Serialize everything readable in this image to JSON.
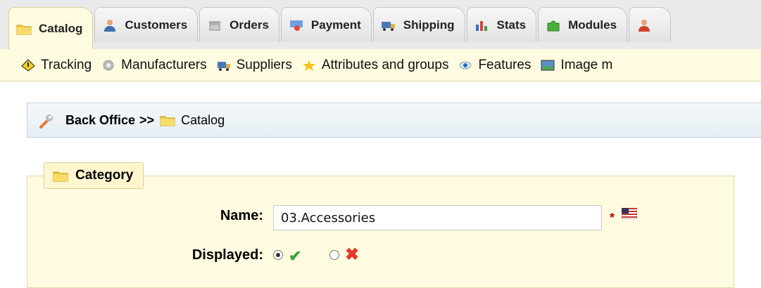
{
  "tabs": [
    {
      "label": "Catalog",
      "icon": "folder-icon",
      "active": true
    },
    {
      "label": "Customers",
      "icon": "customer-icon",
      "active": false
    },
    {
      "label": "Orders",
      "icon": "orders-icon",
      "active": false
    },
    {
      "label": "Payment",
      "icon": "payment-icon",
      "active": false
    },
    {
      "label": "Shipping",
      "icon": "truck-icon",
      "active": false
    },
    {
      "label": "Stats",
      "icon": "bar-chart-icon",
      "active": false
    },
    {
      "label": "Modules",
      "icon": "puzzle-icon",
      "active": false
    }
  ],
  "subnav": [
    {
      "label": "Tracking",
      "icon": "warning-icon"
    },
    {
      "label": "Manufacturers",
      "icon": "gear-icon"
    },
    {
      "label": "Suppliers",
      "icon": "truck-icon"
    },
    {
      "label": "Attributes and groups",
      "icon": "star-icon"
    },
    {
      "label": "Features",
      "icon": "eye-icon"
    },
    {
      "label": "Image m",
      "icon": "image-icon"
    }
  ],
  "breadcrumb": {
    "root": "Back Office",
    "separator": ">>",
    "current": "Catalog"
  },
  "form": {
    "legend": "Category",
    "name_label": "Name:",
    "name_value": "03.Accessories",
    "required_mark": "*",
    "displayed_label": "Displayed:",
    "displayed_value": "yes"
  },
  "colors": {
    "accent_bg": "#fffbe0",
    "accent_border": "#e0d8a6",
    "yes": "#3da33d",
    "no": "#e23a2a"
  }
}
